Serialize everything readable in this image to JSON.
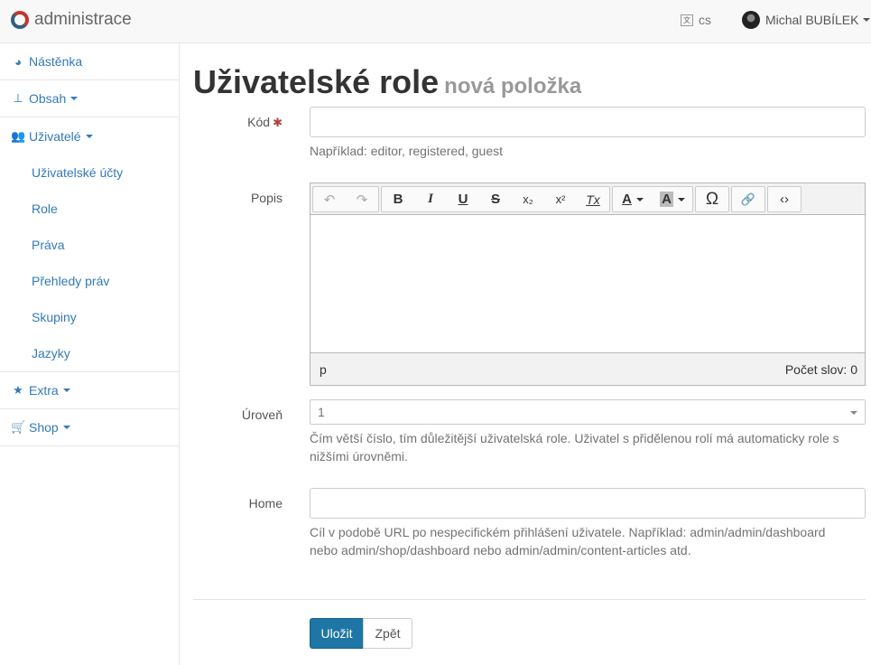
{
  "navbar": {
    "brand": "administrace",
    "lang": "cs",
    "user": "Michal BUBÍLEK"
  },
  "sidebar": {
    "items": [
      {
        "label": "Nástěnka",
        "icon": "dashboard-icon"
      },
      {
        "label": "Obsah",
        "icon": "sitemap-icon"
      },
      {
        "label": "Uživatelé",
        "icon": "users-icon"
      },
      {
        "label": "Extra",
        "icon": "star-icon"
      },
      {
        "label": "Shop",
        "icon": "cart-icon"
      }
    ],
    "users_sub": [
      "Uživatelské účty",
      "Role",
      "Práva",
      "Přehledy práv",
      "Skupiny",
      "Jazyky"
    ]
  },
  "page": {
    "title": "Uživatelské role",
    "subtitle": "nová položka"
  },
  "form": {
    "code_label": "Kód",
    "code_required": "✱",
    "code_value": "",
    "code_help": "Například: editor, registered, guest",
    "description_label": "Popis",
    "editor_status_left": "p",
    "editor_status_right": "Počet slov: 0",
    "level_label": "Úroveň",
    "level_value": "1",
    "level_help": "Čím větší číslo, tím důležitější uživatelská role. Uživatel s přidělenou rolí má automaticky role s nižšími úrovněmi.",
    "home_label": "Home",
    "home_value": "",
    "home_help": "Cíl v podobě URL po nespecifickém přihlášení uživatele. Například: admin/admin/dashboard nebo admin/shop/dashboard nebo admin/admin/content-articles atd.",
    "save_label": "Uložit",
    "back_label": "Zpět"
  },
  "toolbar": {
    "undo": "↶",
    "redo": "↷",
    "bold": "B",
    "italic": "I",
    "underline": "U",
    "strike": "S",
    "subscript": "x₂",
    "superscript": "x²",
    "clear": "Tx",
    "textcolor": "A",
    "bgcolor": "A",
    "special": "Ω",
    "link": "🔗",
    "code": "‹›"
  }
}
